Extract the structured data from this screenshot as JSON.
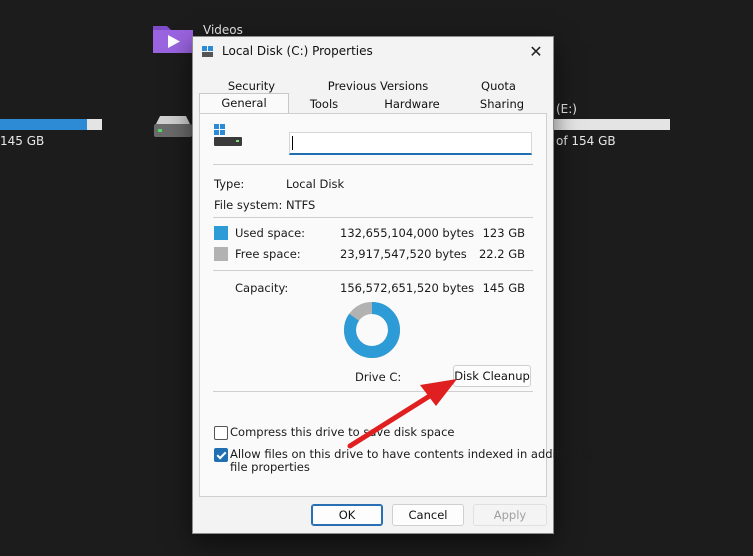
{
  "background": {
    "videos_label": "Videos",
    "drive_c_size": "145 GB",
    "drive_c_used_fraction": 0.85,
    "drive_e_label": "(E:)",
    "drive_e_size": "of 154 GB"
  },
  "dialog": {
    "title": "Local Disk (C:) Properties",
    "close_glyph": "✕",
    "tabs_row1": [
      "Security",
      "Previous Versions",
      "Quota"
    ],
    "tabs_row2": [
      "General",
      "Tools",
      "Hardware",
      "Sharing"
    ],
    "selected_tab": "General",
    "volume_name": "",
    "type_label": "Type:",
    "type_value": "Local Disk",
    "fs_label": "File system:",
    "fs_value": "NTFS",
    "used_label": "Used space:",
    "used_bytes": "132,655,104,000 bytes",
    "used_gb": "123 GB",
    "free_label": "Free space:",
    "free_bytes": "23,917,547,520 bytes",
    "free_gb": "22.2 GB",
    "capacity_label": "Capacity:",
    "capacity_bytes": "156,572,651,520 bytes",
    "capacity_gb": "145 GB",
    "used_fraction": 0.847,
    "drive_label": "Drive C:",
    "cleanup_label": "Disk Cleanup",
    "compress_label": "Compress this drive to save disk space",
    "compress_checked": false,
    "index_label_line1": "Allow files on this drive to have contents indexed in addition to",
    "index_label_line2": "file properties",
    "index_checked": true,
    "ok_label": "OK",
    "cancel_label": "Cancel",
    "apply_label": "Apply"
  },
  "colors": {
    "used": "#2d9bd6",
    "free": "#b2b2b2",
    "accent": "#1f6fb2",
    "annotation_arrow": "#e02020"
  }
}
